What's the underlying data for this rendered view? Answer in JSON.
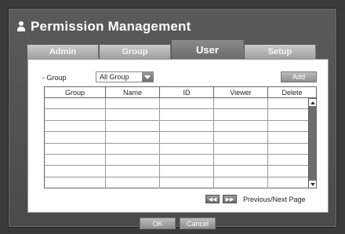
{
  "window": {
    "title": "Permission Management",
    "icon": "user-icon"
  },
  "tabs": [
    {
      "label": "Admin",
      "active": false
    },
    {
      "label": "Group",
      "active": false
    },
    {
      "label": "User",
      "active": true
    },
    {
      "label": "Setup",
      "active": false
    }
  ],
  "filter": {
    "label": "- Group",
    "selected": "All Group"
  },
  "toolbar": {
    "add_label": "Add"
  },
  "table": {
    "columns": [
      "Group",
      "Name",
      "ID",
      "Viewer",
      "Delete"
    ],
    "rows": [
      [],
      [],
      [],
      [],
      [],
      [],
      [],
      []
    ]
  },
  "pager": {
    "prev_label": "◀◀",
    "next_label": "▶▶",
    "label": "Previous/Next Page"
  },
  "footer": {
    "ok_label": "OK",
    "cancel_label": "Cancel"
  },
  "colors": {
    "background": "#3a3a3a",
    "window": "#505050",
    "button": "#a5a5a5"
  }
}
